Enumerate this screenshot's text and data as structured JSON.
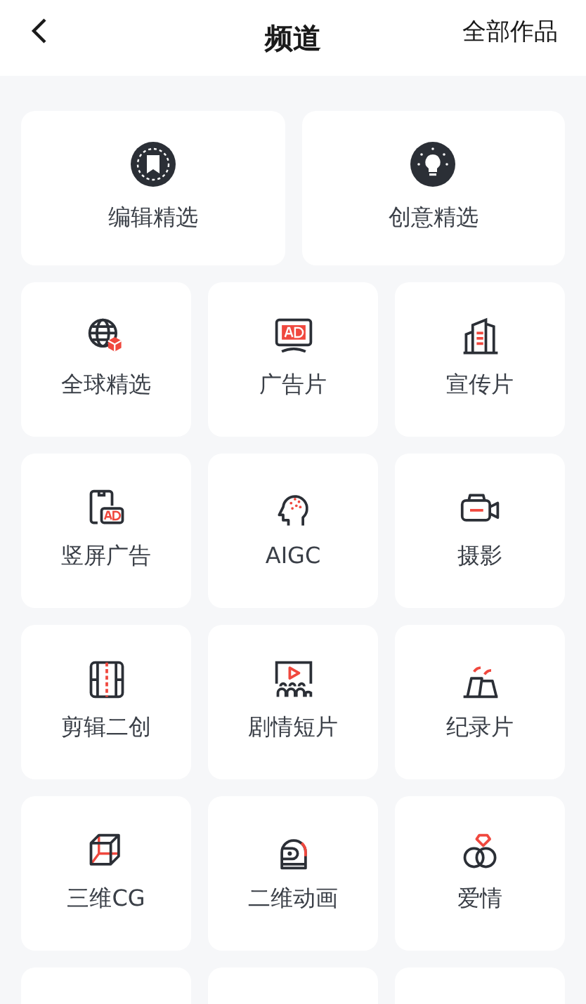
{
  "header": {
    "title": "频道",
    "action": "全部作品"
  },
  "featured": [
    {
      "label": "编辑精选"
    },
    {
      "label": "创意精选"
    }
  ],
  "channels": [
    {
      "label": "全球精选"
    },
    {
      "label": "广告片"
    },
    {
      "label": "宣传片"
    },
    {
      "label": "竖屏广告"
    },
    {
      "label": "AIGC"
    },
    {
      "label": "摄影"
    },
    {
      "label": "剪辑二创"
    },
    {
      "label": "剧情短片"
    },
    {
      "label": "纪录片"
    },
    {
      "label": "三维CG"
    },
    {
      "label": "二维动画"
    },
    {
      "label": "爱情"
    }
  ]
}
